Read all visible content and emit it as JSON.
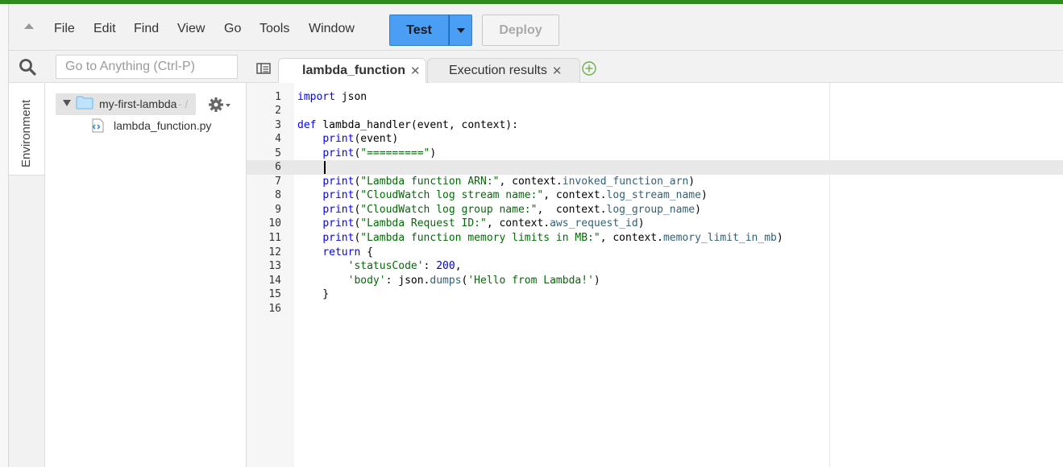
{
  "menu": {
    "items": [
      "File",
      "Edit",
      "Find",
      "View",
      "Go",
      "Tools",
      "Window"
    ],
    "test_label": "Test",
    "deploy_label": "Deploy"
  },
  "search": {
    "placeholder": "Go to Anything (Ctrl-P)"
  },
  "sidebar": {
    "environment_label": "Environment",
    "root_folder": "my-first-lambda",
    "root_suffix": "- /",
    "file": "lambda_function.py"
  },
  "tabs": [
    {
      "label": "lambda_function",
      "active": true
    },
    {
      "label": "Execution results",
      "active": false
    }
  ],
  "editor": {
    "lines": [
      {
        "n": "1",
        "html": "<span class=\"kw\">import</span> json"
      },
      {
        "n": "2",
        "html": ""
      },
      {
        "n": "3",
        "html": "<span class=\"kw\">def</span> lambda_handler(event, context):"
      },
      {
        "n": "4",
        "html": "    <span class=\"fn\">print</span>(event)"
      },
      {
        "n": "5",
        "html": "    <span class=\"fn\">print</span>(<span class=\"str\">\"=========\"</span>)"
      },
      {
        "n": "6",
        "html": ""
      },
      {
        "n": "7",
        "html": "    <span class=\"fn\">print</span>(<span class=\"str\">\"Lambda function ARN:\"</span>, context.<span class=\"attr\">invoked_function_arn</span>)"
      },
      {
        "n": "8",
        "html": "    <span class=\"fn\">print</span>(<span class=\"str\">\"CloudWatch log stream name:\"</span>, context.<span class=\"attr\">log_stream_name</span>)"
      },
      {
        "n": "9",
        "html": "    <span class=\"fn\">print</span>(<span class=\"str\">\"CloudWatch log group name:\"</span>,  context.<span class=\"attr\">log_group_name</span>)"
      },
      {
        "n": "10",
        "html": "    <span class=\"fn\">print</span>(<span class=\"str\">\"Lambda Request ID:\"</span>, context.<span class=\"attr\">aws_request_id</span>)"
      },
      {
        "n": "11",
        "html": "    <span class=\"fn\">print</span>(<span class=\"str\">\"Lambda function memory limits in MB:\"</span>, context.<span class=\"attr\">memory_limit_in_mb</span>)"
      },
      {
        "n": "12",
        "html": "    <span class=\"kw\">return</span> {"
      },
      {
        "n": "13",
        "html": "        <span class=\"str\">'statusCode'</span>: <span class=\"num\">200</span>,"
      },
      {
        "n": "14",
        "html": "        <span class=\"str\">'body'</span>: json.<span class=\"attr\">dumps</span>(<span class=\"str\">'Hello from Lambda!'</span>)"
      },
      {
        "n": "15",
        "html": "    }"
      },
      {
        "n": "16",
        "html": ""
      }
    ]
  },
  "colors": {
    "accent_green": "#2e8b1a",
    "test_button": "#4a9ff5"
  }
}
